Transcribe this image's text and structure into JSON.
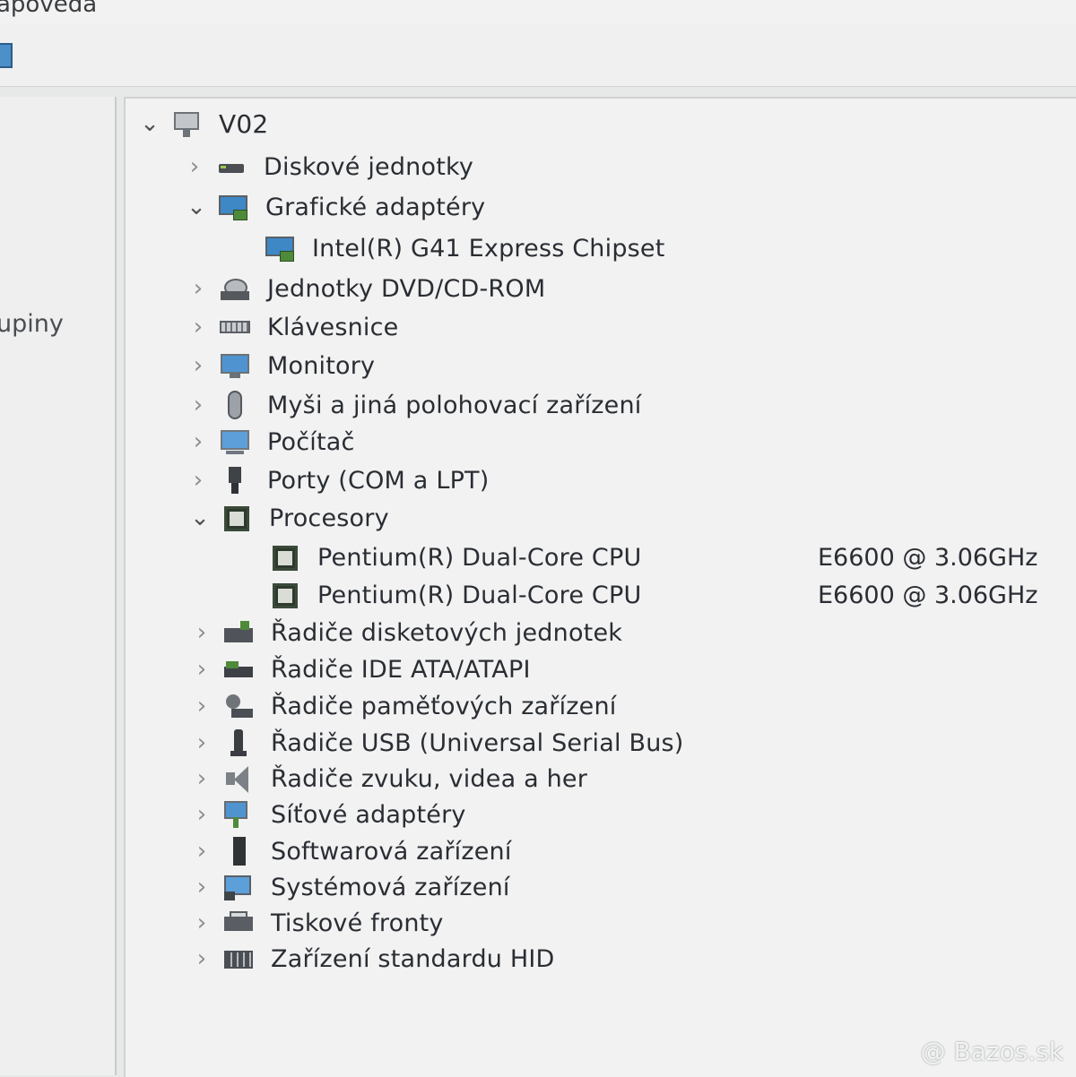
{
  "menubar": {
    "help_label": "Nápověda"
  },
  "left_pane": {
    "text": "skupiny"
  },
  "tree": {
    "root": "V02",
    "categories": {
      "disk": "Diskové jednotky",
      "gpu": "Grafické adaptéry",
      "gpu_child": "Intel(R) G41 Express Chipset",
      "dvd": "Jednotky DVD/CD-ROM",
      "keyboard": "Klávesnice",
      "monitors": "Monitory",
      "mice": "Myši a jiná polohovací zařízení",
      "computer": "Počítač",
      "ports": "Porty (COM a LPT)",
      "processors": "Procesory",
      "cpu1_name": "Pentium(R) Dual-Core  CPU",
      "cpu1_model": "E6600  @ 3.06GHz",
      "cpu2_name": "Pentium(R) Dual-Core  CPU",
      "cpu2_model": "E6600  @ 3.06GHz",
      "floppy": "Řadiče disketových jednotek",
      "ide": "Řadiče IDE ATA/ATAPI",
      "storage": "Řadiče paměťových zařízení",
      "usb": "Řadiče USB (Universal Serial Bus)",
      "sound": "Řadiče zvuku, videa a her",
      "network": "Síťové adaptéry",
      "software": "Softwarová zařízení",
      "system": "Systémová zařízení",
      "print": "Tiskové fronty",
      "hid": "Zařízení standardu HID"
    },
    "icons": {
      "expand_collapsed": "›",
      "expand_open": "⌄"
    }
  },
  "watermark": "@ Bazos.sk"
}
